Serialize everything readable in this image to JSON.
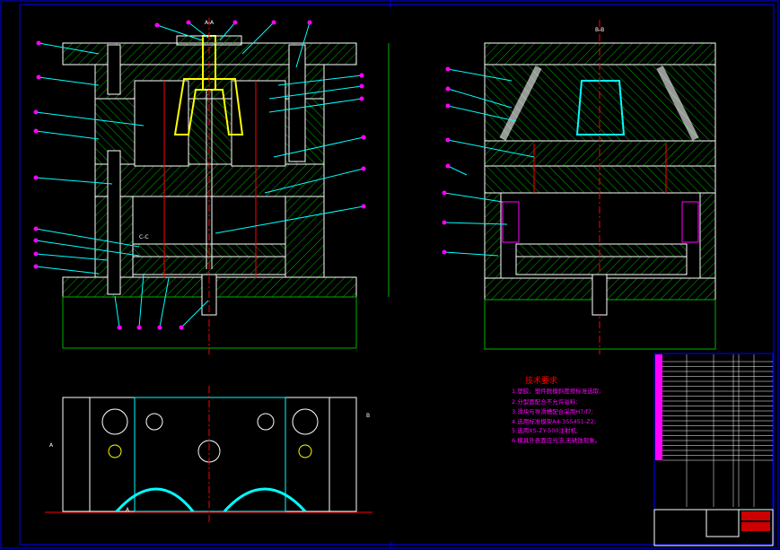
{
  "drawing": {
    "tech_requirements": {
      "title": "技术要求",
      "items": [
        "1.塑胶、塑件脱模斜度按标准选取;",
        "2.分型面配合不允许溢料;",
        "3.滑块与导滑槽配合采用H7/f7;",
        "4.选用标准模架A4-355451-Z2;",
        "5.选用XS-ZY-500注射机;",
        "6.模具外表面应光洁,无锈蚀现象。"
      ]
    },
    "section_labels": {
      "main_top": "A-A",
      "side_top": "B-B",
      "detail": "C-C",
      "plan_a1": "A",
      "plan_a2": "A",
      "plan_b": "B"
    },
    "colors": {
      "background": "#000000",
      "frame": "#0000ff",
      "hatch": "#00cc00",
      "outline": "#ffffff",
      "leader": "#00ffff",
      "balloon": "#ff00ff",
      "centerline": "#ff0000",
      "part": "#ffff00",
      "text_requirements": "#ff00ff",
      "text_title": "#ff0000"
    }
  }
}
